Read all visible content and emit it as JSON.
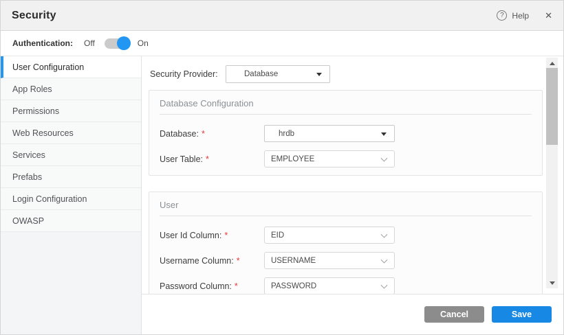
{
  "header": {
    "title": "Security",
    "help_label": "Help",
    "help_icon": "?",
    "close_icon": "✕"
  },
  "auth": {
    "label": "Authentication:",
    "off_label": "Off",
    "on_label": "On",
    "state": "on"
  },
  "sidebar": {
    "items": [
      {
        "label": "User Configuration",
        "active": true
      },
      {
        "label": "App Roles",
        "active": false
      },
      {
        "label": "Permissions",
        "active": false
      },
      {
        "label": "Web Resources",
        "active": false
      },
      {
        "label": "Services",
        "active": false
      },
      {
        "label": "Prefabs",
        "active": false
      },
      {
        "label": "Login Configuration",
        "active": false
      },
      {
        "label": "OWASP",
        "active": false
      }
    ]
  },
  "provider": {
    "label": "Security Provider:",
    "value": "Database"
  },
  "panels": [
    {
      "title": "Database Configuration",
      "fields": [
        {
          "label": "Database:",
          "required": "*",
          "value": "hrdb"
        },
        {
          "label": "User Table:",
          "required": "*",
          "value": "EMPLOYEE"
        }
      ]
    },
    {
      "title": "User",
      "fields": [
        {
          "label": "User Id Column:",
          "required": "*",
          "value": "EID"
        },
        {
          "label": "Username Column:",
          "required": "*",
          "value": "USERNAME"
        },
        {
          "label": "Password Column:",
          "required": "*",
          "value": "PASSWORD"
        }
      ]
    }
  ],
  "footer": {
    "cancel_label": "Cancel",
    "save_label": "Save"
  },
  "colors": {
    "accent": "#2196f3",
    "save_button": "#1788e4",
    "cancel_button": "#8c8c8c",
    "required_marker": "#e53935"
  }
}
